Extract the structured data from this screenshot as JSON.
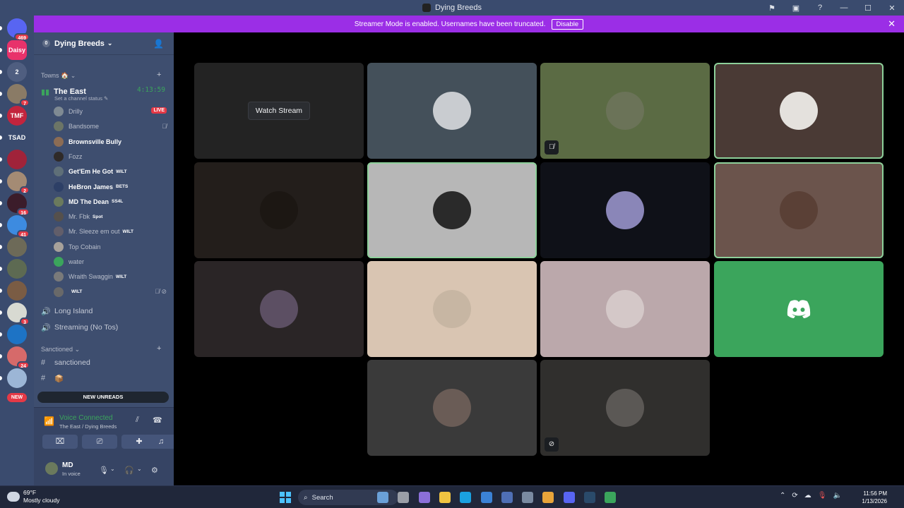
{
  "window": {
    "title": "Dying Breeds"
  },
  "banner": {
    "text": "Streamer Mode is enabled. Usernames have been truncated.",
    "button": "Disable"
  },
  "guilds": [
    {
      "label": "",
      "badge": "469",
      "color": "#5865f2"
    },
    {
      "label": "Daisy",
      "badge": "",
      "color": "#e8326b"
    },
    {
      "label": "2",
      "badge": "",
      "color": "#4f5e80"
    },
    {
      "label": "",
      "badge": "7",
      "color": "#8a7b66"
    },
    {
      "label": "TMF",
      "badge": "",
      "color": "#c3243d"
    },
    {
      "label": "TSAD",
      "badge": "",
      "color": "#3a4b6e"
    },
    {
      "label": "",
      "badge": "",
      "color": "#a0233a"
    },
    {
      "label": "",
      "badge": "2",
      "color": "#a48b74"
    },
    {
      "label": "",
      "badge": "16",
      "color": "#3b1c2a"
    },
    {
      "label": "",
      "badge": "41",
      "color": "#3d8be0"
    },
    {
      "label": "",
      "badge": "",
      "color": "#6d6a58"
    },
    {
      "label": "",
      "badge": "",
      "color": "#5d6a52"
    },
    {
      "label": "",
      "badge": "",
      "color": "#7a5c44"
    },
    {
      "label": "",
      "badge": "3",
      "color": "#d8dad2"
    },
    {
      "label": "",
      "badge": "",
      "color": "#1d73c5"
    },
    {
      "label": "",
      "badge": "24",
      "color": "#d66a6a"
    },
    {
      "label": "",
      "badge": "",
      "color": "#9cb6d6"
    }
  ],
  "guild_new_badge": "NEW",
  "server": {
    "name": "Dying Breeds"
  },
  "categories": {
    "towns": "Towns 🏠",
    "sanctioned": "Sanctioned"
  },
  "active_channel": {
    "name": "The East",
    "timer": "4:13:59",
    "status_hint": "Set a channel status ✎"
  },
  "voice_users": [
    {
      "name": "Drilly",
      "tag": "",
      "live": "LIVE",
      "speaking": false,
      "muted": "",
      "color": "#7f8a93"
    },
    {
      "name": "Bandsome",
      "tag": "",
      "live": "",
      "speaking": false,
      "muted": "🎙̸",
      "color": "#6c7566"
    },
    {
      "name": "Brownsville Bully",
      "tag": "",
      "live": "",
      "speaking": true,
      "muted": "",
      "color": "#8c6c54"
    },
    {
      "name": "Fozz",
      "tag": "",
      "live": "",
      "speaking": false,
      "muted": "",
      "color": "#2f2a28"
    },
    {
      "name": "Get'Em He Got",
      "tag": "WILT",
      "live": "",
      "speaking": true,
      "muted": "",
      "color": "#5f6f78"
    },
    {
      "name": "HeBron James",
      "tag": "BETS",
      "live": "",
      "speaking": true,
      "muted": "",
      "color": "#2d3f66"
    },
    {
      "name": "MD The Dean",
      "tag": "SS4L",
      "live": "",
      "speaking": true,
      "muted": "",
      "color": "#6b7a5d"
    },
    {
      "name": "Mr. Fbk",
      "tag": "Spot",
      "live": "",
      "speaking": false,
      "muted": "",
      "color": "#55504c"
    },
    {
      "name": "Mr. Sleeze em out",
      "tag": "WILT",
      "live": "",
      "speaking": false,
      "muted": "",
      "color": "#625e6a"
    },
    {
      "name": "Top Cobain",
      "tag": "",
      "live": "",
      "speaking": false,
      "muted": "",
      "color": "#a7a19a"
    },
    {
      "name": "water",
      "tag": "",
      "live": "",
      "speaking": false,
      "muted": "",
      "color": "#3ba55c"
    },
    {
      "name": "Wraith Swaggin",
      "tag": "WILT",
      "live": "",
      "speaking": false,
      "muted": "",
      "color": "#7a7a7a"
    },
    {
      "name": "",
      "tag": "WILT",
      "live": "",
      "speaking": false,
      "muted": "🎙̸ ⊘",
      "color": "#696969"
    }
  ],
  "channels": [
    {
      "icon": "🔊",
      "name": "Long Island"
    },
    {
      "icon": "🔊",
      "name": "Streaming (No Tos)"
    },
    {
      "icon": "#",
      "name": "sanctioned"
    },
    {
      "icon": "#",
      "name": "📦"
    }
  ],
  "new_unreads": "NEW UNREADS",
  "voice_panel": {
    "status": "Voice Connected",
    "subtitle": "The East / Dying Breeds"
  },
  "user": {
    "name": "MD",
    "status": "In voice"
  },
  "stage": {
    "watch_label": "Watch Stream",
    "tiles": [
      {
        "bg": "#232323",
        "pfp": "",
        "speaking": false,
        "icon": "",
        "kind": "stream"
      },
      {
        "bg": "#44505a",
        "pfp": "#c9ccd0",
        "speaking": false,
        "icon": "",
        "kind": "user"
      },
      {
        "bg": "#5b6b44",
        "pfp": "#6b7358",
        "speaking": false,
        "icon": "🎙̸",
        "kind": "user"
      },
      {
        "bg": "#4a3a35",
        "pfp": "#e4e1dd",
        "speaking": true,
        "icon": "",
        "kind": "user"
      },
      {
        "bg": "#231e1b",
        "pfp": "#1c1713",
        "speaking": false,
        "icon": "",
        "kind": "user"
      },
      {
        "bg": "#b7b7b7",
        "pfp": "#2a2a2a",
        "speaking": true,
        "icon": "",
        "kind": "user"
      },
      {
        "bg": "#0f1118",
        "pfp": "#8a86b8",
        "speaking": false,
        "icon": "",
        "kind": "user"
      },
      {
        "bg": "#6b544c",
        "pfp": "#5a4036",
        "speaking": true,
        "icon": "",
        "kind": "user"
      },
      {
        "bg": "#2a2526",
        "pfp": "#5c4f63",
        "speaking": false,
        "icon": "",
        "kind": "user"
      },
      {
        "bg": "#d9c5b2",
        "pfp": "#c7b6a3",
        "speaking": false,
        "icon": "",
        "kind": "user"
      },
      {
        "bg": "#bba8ab",
        "pfp": "#d4c8c8",
        "speaking": false,
        "icon": "",
        "kind": "user"
      },
      {
        "bg": "#3ba55c",
        "pfp": "",
        "speaking": false,
        "icon": "",
        "kind": "discord"
      },
      {
        "bg": "#3a3a3a",
        "pfp": "#6a5c56",
        "speaking": false,
        "icon": "",
        "kind": "user"
      },
      {
        "bg": "#302f2d",
        "pfp": "#5b5855",
        "speaking": false,
        "icon": "⊘",
        "kind": "user"
      }
    ]
  },
  "taskbar": {
    "weather_temp": "69°F",
    "weather_desc": "Mostly cloudy",
    "search": "Search",
    "time": "11:56 PM",
    "date": "1/13/2026",
    "apps": [
      "#6aa0d8",
      "#9a9ea7",
      "#8b6fd8",
      "#f0c341",
      "#1aa1e0",
      "#3b82d6",
      "#4f6fb5",
      "#7a8aa1",
      "#e8a43a",
      "#5865f2",
      "#2a4a6a",
      "#3ba55c"
    ]
  }
}
